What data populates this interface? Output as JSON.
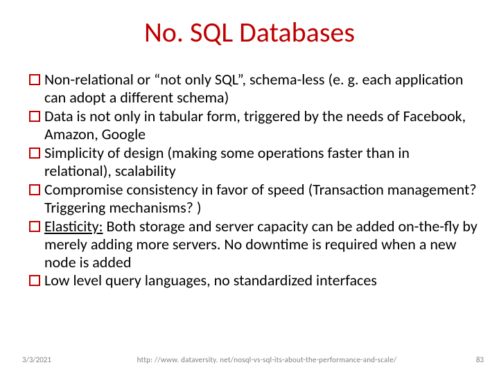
{
  "title": "No. SQL Databases",
  "bullets": [
    "Non-relational or “not only SQL”, schema-less (e. g. each application can adopt a different schema)",
    "Data is not only in tabular form, triggered by the needs of Facebook, Amazon, Google",
    "Simplicity of design (making some operations faster than in relational), scalability",
    "Compromise consistency in favor of speed (Transaction management? Triggering mechanisms? )",
    {
      "underline": "Elasticity:",
      "rest": " Both storage and server capacity can be added  on-the-fly by merely adding more servers. No downtime is required when a new node is added"
    },
    "Low level query languages, no standardized interfaces"
  ],
  "footer": {
    "date": "3/3/2021",
    "source": "http: //www. dataversity. net/nosql-vs-sql-its-about-the-performance-and-scale/",
    "page": "83"
  },
  "colors": {
    "title": "#c00000",
    "bullet_outline": "#c00000",
    "footer": "#808080"
  }
}
